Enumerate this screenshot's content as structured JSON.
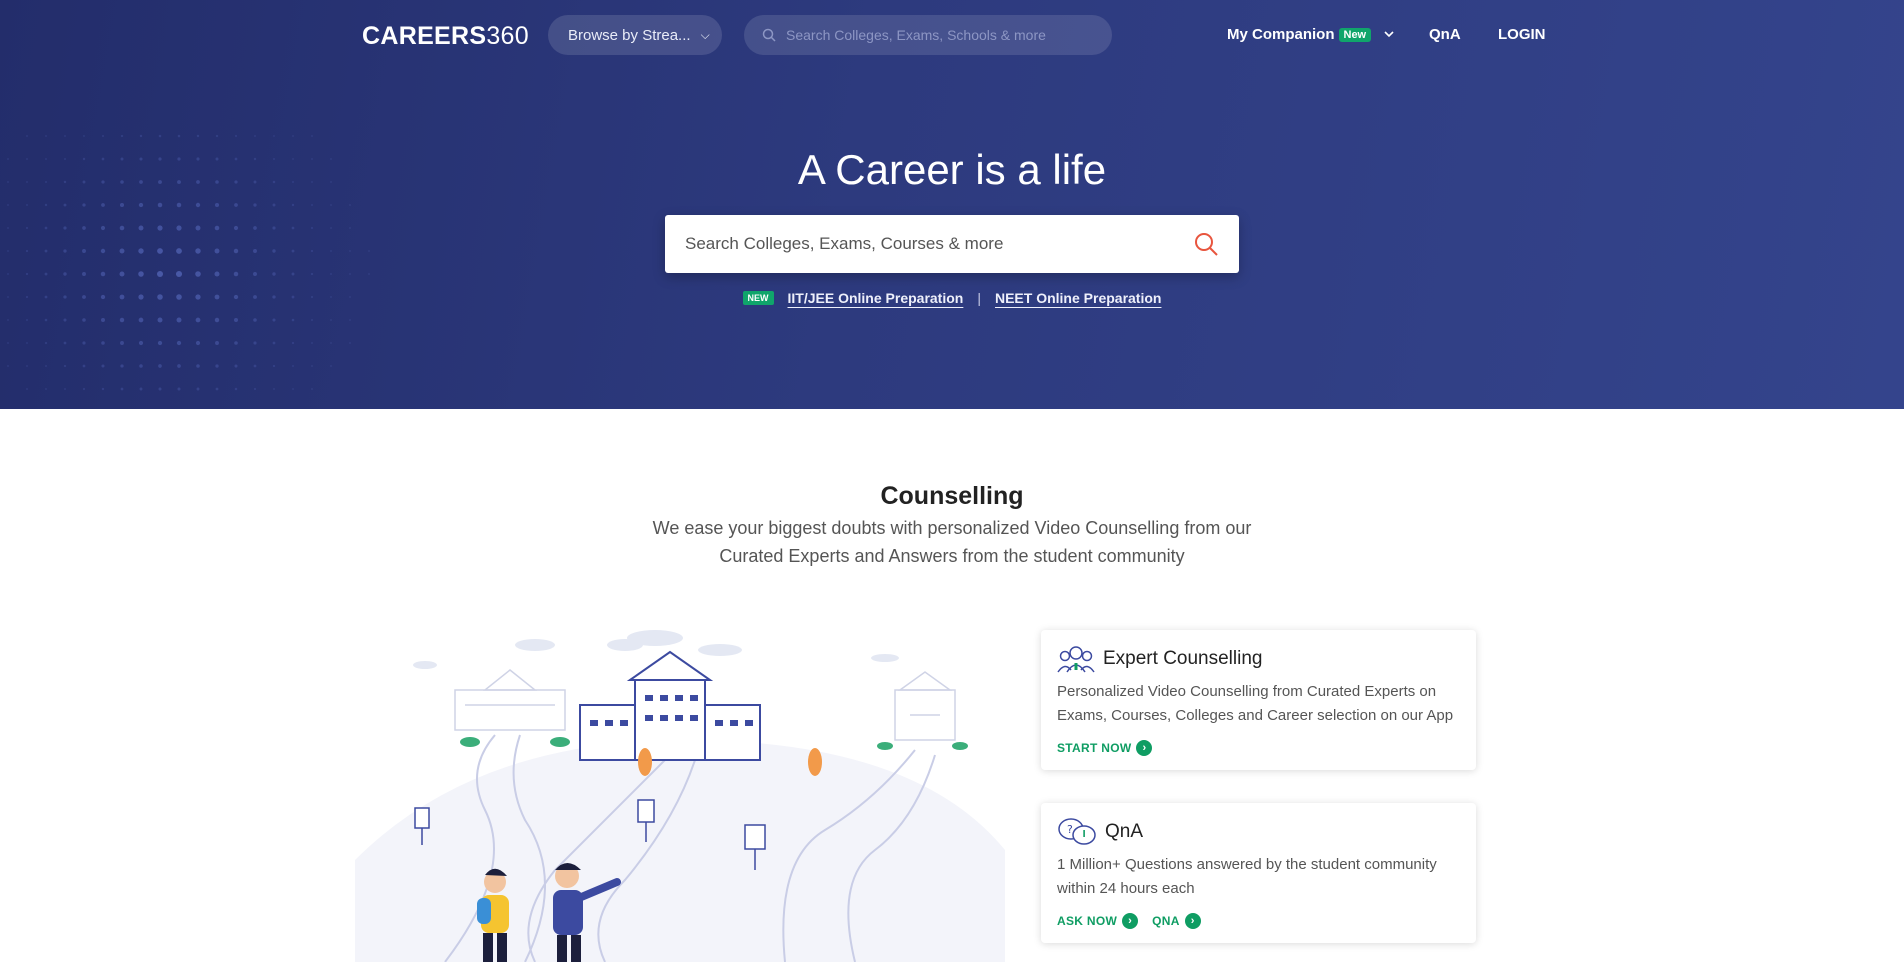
{
  "header": {
    "logo_main": "CAREERS",
    "logo_num": "360",
    "browse_label": "Browse by Strea...",
    "search_placeholder": "Search Colleges, Exams, Schools & more",
    "nav_companion": "My Companion",
    "nav_companion_badge": "New",
    "nav_qna": "QnA",
    "nav_login": "LOGIN"
  },
  "hero": {
    "title": "A Career is a life",
    "search_placeholder": "Search Colleges, Exams, Courses & more",
    "badge": "NEW",
    "link_iit": "IIT/JEE Online Preparation",
    "separator": "|",
    "link_neet": "NEET Online Preparation"
  },
  "counselling": {
    "title": "Counselling",
    "subtitle_line1": "We ease your biggest doubts with personalized Video Counselling from our",
    "subtitle_line2": "Curated Experts and Answers from the student community",
    "cards": [
      {
        "title": "Expert Counselling",
        "description": "Personalized Video Counselling from Curated Experts on Exams, Courses, Colleges and Career selection on our App",
        "actions": [
          "START NOW"
        ]
      },
      {
        "title": "QnA",
        "description": "1 Million+ Questions answered by the student community within 24 hours each",
        "actions": [
          "ASK NOW",
          "QNA"
        ]
      }
    ]
  },
  "colors": {
    "hero_bg": "#2d3a7e",
    "accent_green": "#0f9d63",
    "search_icon": "#e8553e"
  },
  "icons": {
    "top_search": "search-icon",
    "hero_search": "search-icon",
    "expert": "expert-people-icon",
    "qna": "chat-bubbles-icon",
    "action": "arrow-right-circle-icon"
  }
}
